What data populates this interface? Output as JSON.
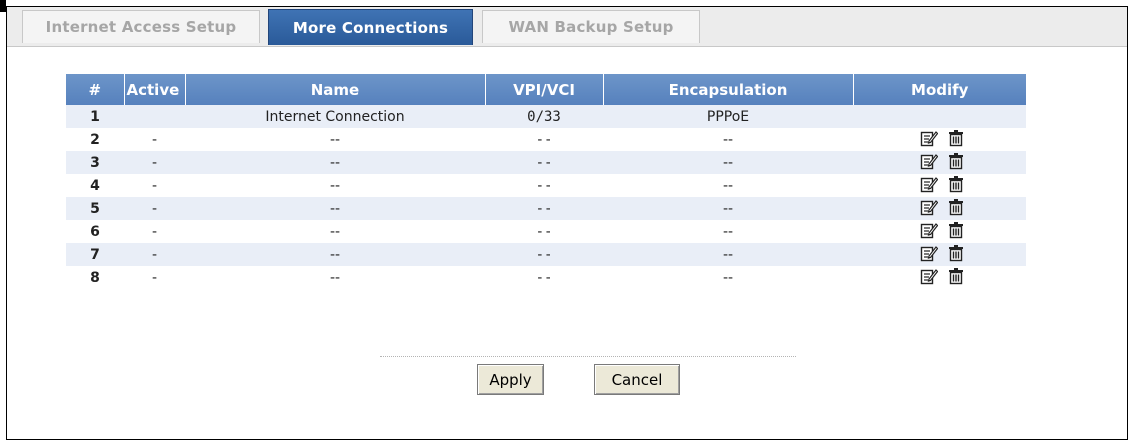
{
  "tabs": [
    {
      "label": "Internet Access Setup",
      "active": false
    },
    {
      "label": "More Connections",
      "active": true
    },
    {
      "label": "WAN Backup Setup",
      "active": false
    }
  ],
  "table": {
    "headers": [
      "#",
      "Active",
      "Name",
      "VPI/VCI",
      "Encapsulation",
      "Modify"
    ],
    "rows": [
      {
        "num": "1",
        "active": "",
        "name": "Internet Connection",
        "vpivci": "0/33",
        "encap": "PPPoE",
        "editable": false
      },
      {
        "num": "2",
        "active": "-",
        "name": "--",
        "vpivci": "--",
        "encap": "--",
        "editable": true
      },
      {
        "num": "3",
        "active": "-",
        "name": "--",
        "vpivci": "--",
        "encap": "--",
        "editable": true
      },
      {
        "num": "4",
        "active": "-",
        "name": "--",
        "vpivci": "--",
        "encap": "--",
        "editable": true
      },
      {
        "num": "5",
        "active": "-",
        "name": "--",
        "vpivci": "--",
        "encap": "--",
        "editable": true
      },
      {
        "num": "6",
        "active": "-",
        "name": "--",
        "vpivci": "--",
        "encap": "--",
        "editable": true
      },
      {
        "num": "7",
        "active": "-",
        "name": "--",
        "vpivci": "--",
        "encap": "--",
        "editable": true
      },
      {
        "num": "8",
        "active": "-",
        "name": "--",
        "vpivci": "--",
        "encap": "--",
        "editable": true
      }
    ],
    "modify_icons": [
      "edit-icon",
      "delete-icon"
    ]
  },
  "buttons": {
    "apply": "Apply",
    "cancel": "Cancel"
  },
  "colors": {
    "header_blue": "#5f8bc4",
    "active_tab": "#2f62a6",
    "row_shade": "#e9eef7"
  }
}
